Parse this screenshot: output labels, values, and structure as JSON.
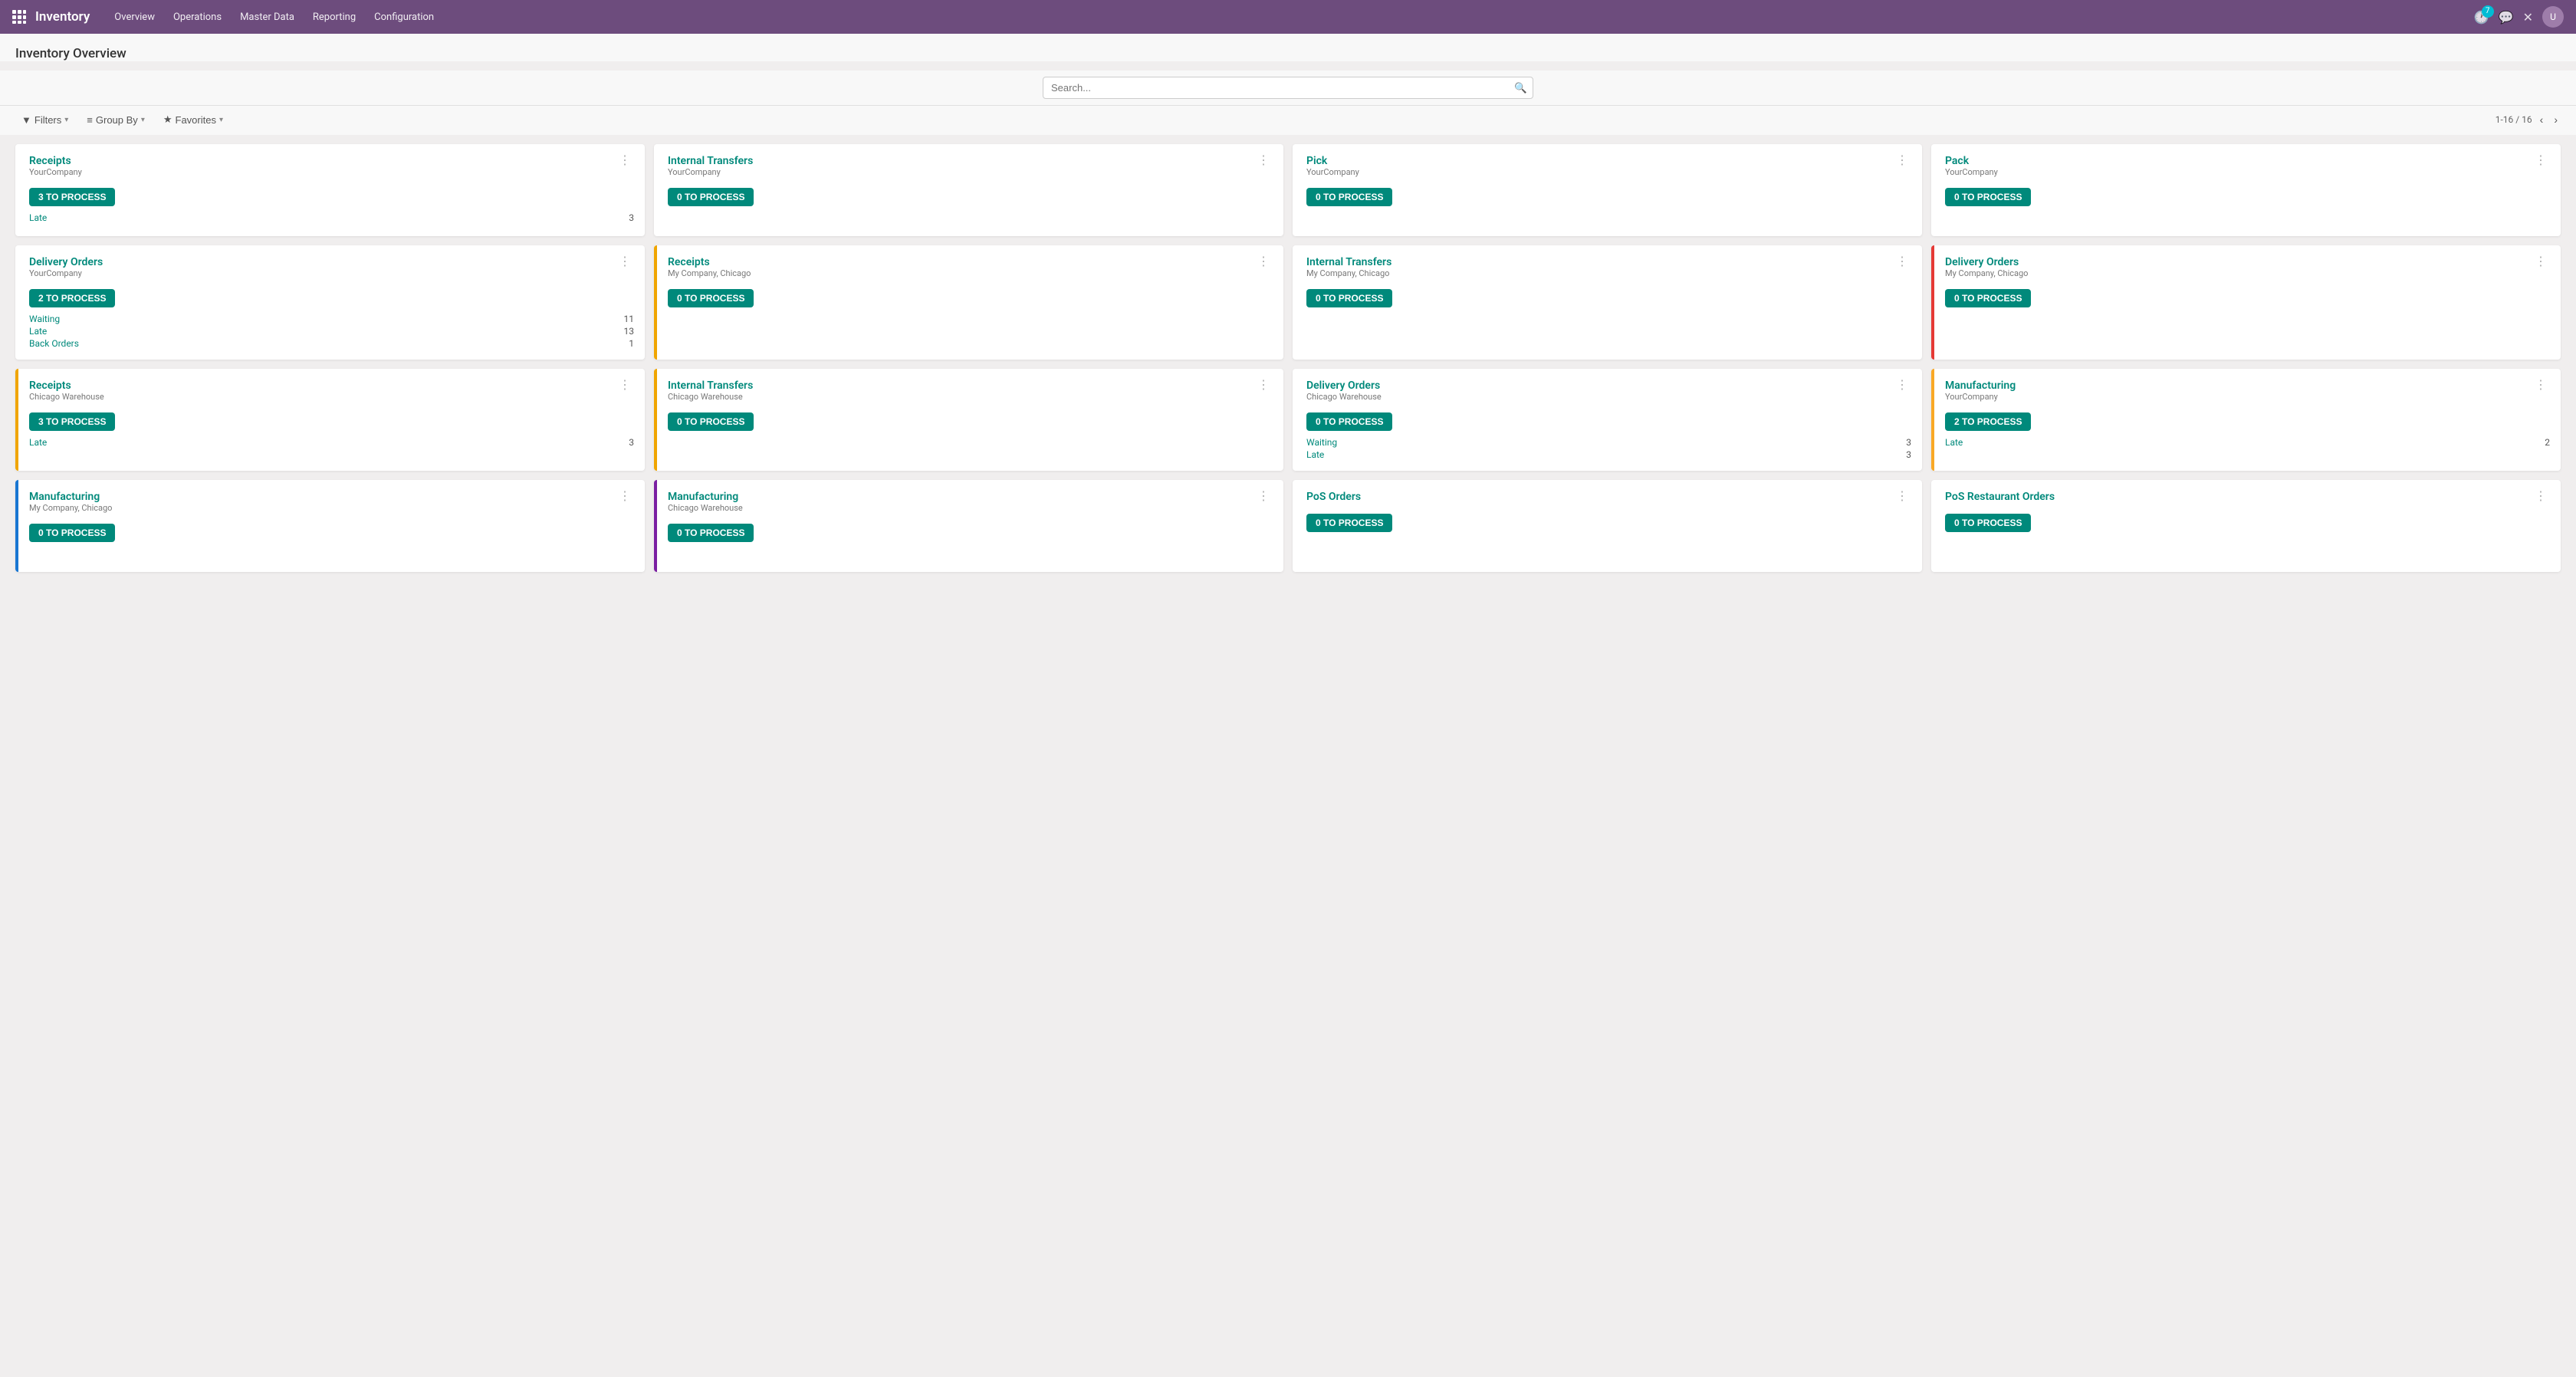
{
  "app": {
    "title": "Inventory",
    "badge_count": "7"
  },
  "nav": {
    "items": [
      "Overview",
      "Operations",
      "Master Data",
      "Reporting",
      "Configuration"
    ]
  },
  "page": {
    "title": "Inventory Overview"
  },
  "search": {
    "placeholder": "Search..."
  },
  "filters": {
    "filter_label": "Filters",
    "group_by_label": "Group By",
    "favorites_label": "Favorites",
    "pagination": "1-16 / 16"
  },
  "cards": [
    {
      "title": "Receipts",
      "subtitle": "YourCompany",
      "button_label": "3 TO PROCESS",
      "border": "none",
      "stats": [
        {
          "label": "Late",
          "value": "3"
        }
      ]
    },
    {
      "title": "Internal Transfers",
      "subtitle": "YourCompany",
      "button_label": "0 TO PROCESS",
      "border": "none",
      "stats": []
    },
    {
      "title": "Pick",
      "subtitle": "YourCompany",
      "button_label": "0 TO PROCESS",
      "border": "none",
      "stats": []
    },
    {
      "title": "Pack",
      "subtitle": "YourCompany",
      "button_label": "0 TO PROCESS",
      "border": "none",
      "stats": []
    },
    {
      "title": "Delivery Orders",
      "subtitle": "YourCompany",
      "button_label": "2 TO PROCESS",
      "border": "none",
      "stats": [
        {
          "label": "Waiting",
          "value": "11"
        },
        {
          "label": "Late",
          "value": "13"
        },
        {
          "label": "Back Orders",
          "value": "1"
        }
      ]
    },
    {
      "title": "Receipts",
      "subtitle": "My Company, Chicago",
      "button_label": "0 TO PROCESS",
      "border": "orange",
      "stats": []
    },
    {
      "title": "Internal Transfers",
      "subtitle": "My Company, Chicago",
      "button_label": "0 TO PROCESS",
      "border": "none",
      "stats": []
    },
    {
      "title": "Delivery Orders",
      "subtitle": "My Company, Chicago",
      "button_label": "0 TO PROCESS",
      "border": "red",
      "stats": []
    },
    {
      "title": "Receipts",
      "subtitle": "Chicago Warehouse",
      "button_label": "3 TO PROCESS",
      "border": "orange",
      "stats": [
        {
          "label": "Late",
          "value": "3"
        }
      ]
    },
    {
      "title": "Internal Transfers",
      "subtitle": "Chicago Warehouse",
      "button_label": "0 TO PROCESS",
      "border": "orange",
      "stats": []
    },
    {
      "title": "Delivery Orders",
      "subtitle": "Chicago Warehouse",
      "button_label": "0 TO PROCESS",
      "border": "none",
      "stats": [
        {
          "label": "Waiting",
          "value": "3"
        },
        {
          "label": "Late",
          "value": "3"
        }
      ]
    },
    {
      "title": "Manufacturing",
      "subtitle": "YourCompany",
      "button_label": "2 TO PROCESS",
      "border": "yellow",
      "stats": [
        {
          "label": "Late",
          "value": "2"
        }
      ]
    },
    {
      "title": "Manufacturing",
      "subtitle": "My Company, Chicago",
      "button_label": "0 TO PROCESS",
      "border": "blue",
      "stats": []
    },
    {
      "title": "Manufacturing",
      "subtitle": "Chicago Warehouse",
      "button_label": "0 TO PROCESS",
      "border": "purple",
      "stats": []
    },
    {
      "title": "PoS Orders",
      "subtitle": "",
      "button_label": "0 TO PROCESS",
      "border": "none",
      "stats": []
    },
    {
      "title": "PoS Restaurant Orders",
      "subtitle": "",
      "button_label": "0 TO PROCESS",
      "border": "none",
      "stats": []
    }
  ]
}
